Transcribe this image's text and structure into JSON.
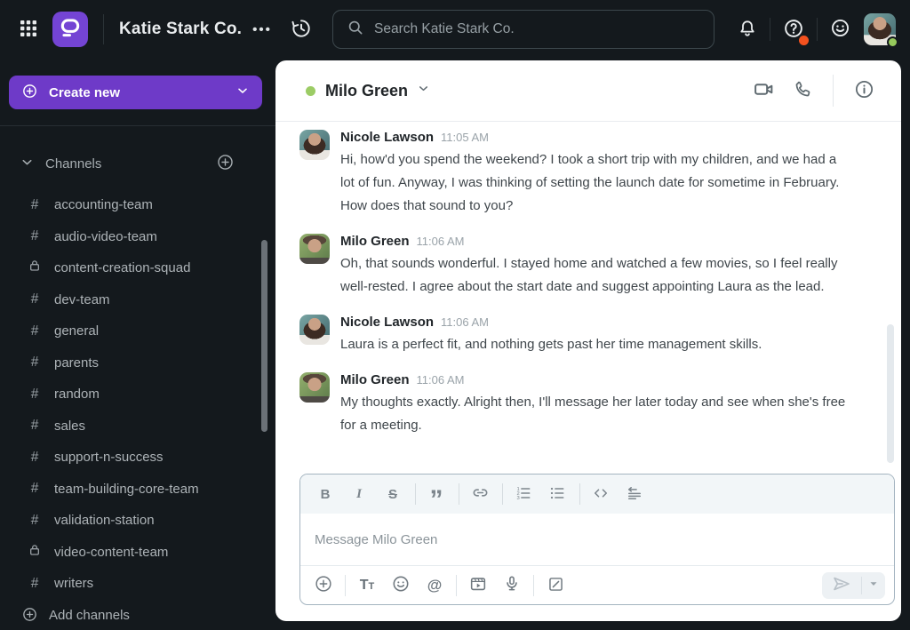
{
  "topbar": {
    "workspace_name": "Katie Stark Co.",
    "more_glyph": "•••",
    "search_placeholder": "Search Katie Stark Co."
  },
  "sidebar": {
    "create_new_label": "Create new",
    "channels_header_label": "Channels",
    "add_channels_label": "Add channels",
    "channels": [
      {
        "name": "accounting-team",
        "visibility": "public"
      },
      {
        "name": "audio-video-team",
        "visibility": "public"
      },
      {
        "name": "content-creation-squad",
        "visibility": "private"
      },
      {
        "name": "dev-team",
        "visibility": "public"
      },
      {
        "name": "general",
        "visibility": "public"
      },
      {
        "name": "parents",
        "visibility": "public"
      },
      {
        "name": "random",
        "visibility": "public"
      },
      {
        "name": "sales",
        "visibility": "public"
      },
      {
        "name": "support-n-success",
        "visibility": "public"
      },
      {
        "name": "team-building-core-team",
        "visibility": "public"
      },
      {
        "name": "validation-station",
        "visibility": "public"
      },
      {
        "name": "video-content-team",
        "visibility": "private"
      },
      {
        "name": "writers",
        "visibility": "public"
      }
    ]
  },
  "chat": {
    "title": "Milo Green",
    "status": "online",
    "messages": [
      {
        "author": "Nicole Lawson",
        "time": "11:05 AM",
        "text": "Hi, how'd you spend the weekend? I took a short trip with my children, and we had a lot of fun. Anyway, I was thinking of setting the launch date for sometime in February. How does that sound to you?"
      },
      {
        "author": "Milo Green",
        "time": "11:06 AM",
        "text": "Oh, that sounds wonderful. I stayed home and watched a few movies, so I feel really well-rested. I agree about the start date and suggest appointing Laura as the lead."
      },
      {
        "author": "Nicole Lawson",
        "time": "11:06 AM",
        "text": "Laura is a perfect fit, and nothing gets past her time management skills."
      },
      {
        "author": "Milo Green",
        "time": "11:06 AM",
        "text": "My thoughts exactly. Alright then, I'll message her later today and see when she's free for a meeting."
      }
    ]
  },
  "composer": {
    "placeholder": "Message Milo Green"
  },
  "icons": {
    "hash": "#",
    "bold": "B",
    "italic": "I",
    "strikethrough": "S",
    "blockquote": "”",
    "mention": "@",
    "text_format_primary": "T",
    "text_format_secondary": "T"
  },
  "colors": {
    "accent_purple": "#6e3ac8",
    "online_green": "#9ccc65",
    "alert_orange": "#f4511e",
    "dark_bg": "#14191d",
    "panel_white": "#ffffff"
  }
}
